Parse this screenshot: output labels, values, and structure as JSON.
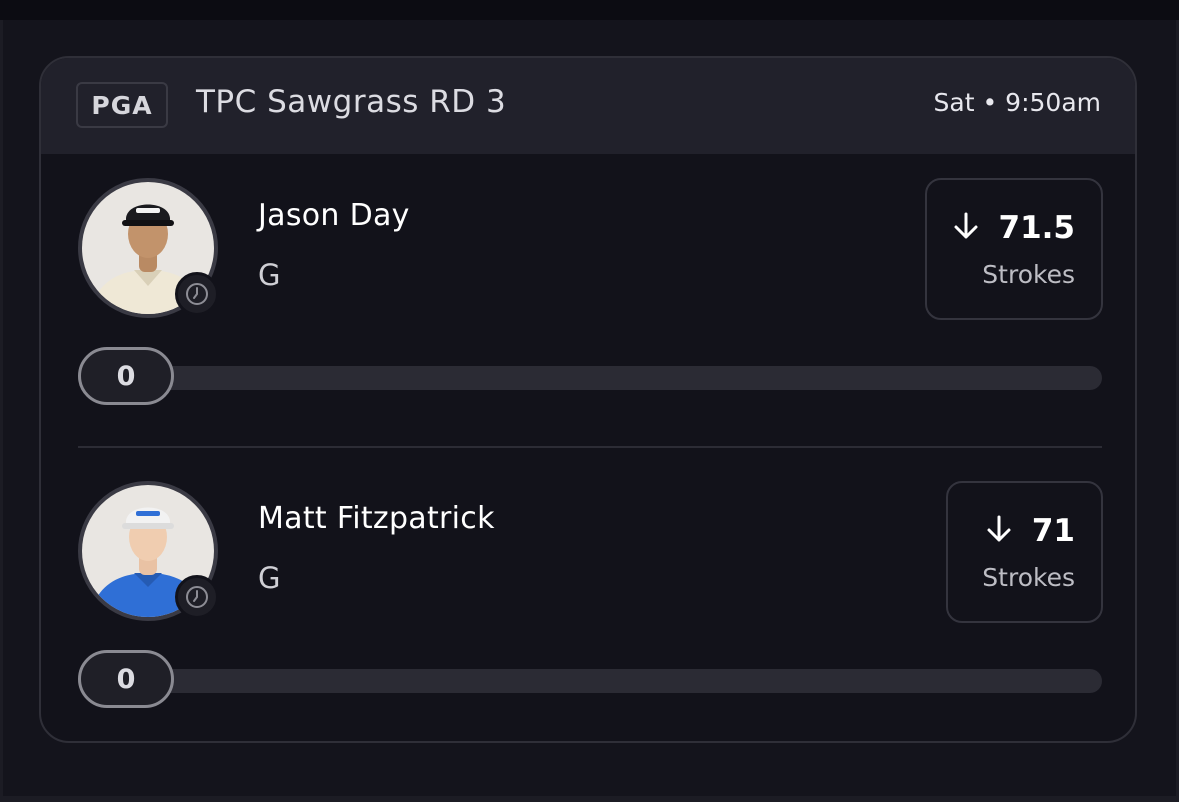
{
  "card": {
    "league": "PGA",
    "event": "TPC Sawgrass RD 3",
    "time": "Sat • 9:50am"
  },
  "players": [
    {
      "name": "Jason Day",
      "position": "G",
      "direction_icon": "arrow-down-icon",
      "line": "71.5",
      "stat": "Strokes",
      "progress": "0",
      "progress_fraction": 0,
      "shirt_color": "#efe8d6",
      "cap_color": "#1b1b1f"
    },
    {
      "name": "Matt Fitzpatrick",
      "position": "G",
      "direction_icon": "arrow-down-icon",
      "line": "71",
      "stat": "Strokes",
      "progress": "0",
      "progress_fraction": 0,
      "shirt_color": "#2f6fd6",
      "cap_color": "#f2f2f2"
    }
  ]
}
